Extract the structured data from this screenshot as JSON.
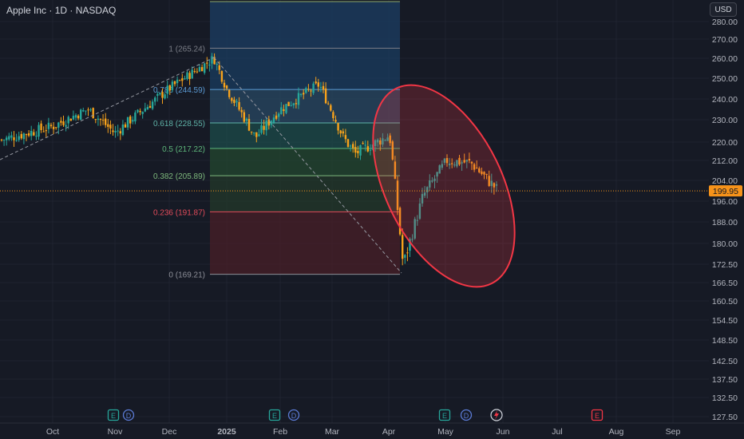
{
  "header": {
    "title": "Apple Inc · 1D · NASDAQ",
    "currency": "USD"
  },
  "colors": {
    "background": "#161a25",
    "up": "#26a69a",
    "down": "#f7a21b",
    "ellipse": "#f23645",
    "last_price_bg": "#f7931a"
  },
  "chart_data": {
    "type": "candlestick",
    "title": "",
    "xlabel": "",
    "ylabel": "",
    "ylim": [
      125,
      284
    ],
    "y_ticks": [
      "280.00",
      "270.00",
      "260.00",
      "250.00",
      "240.00",
      "230.00",
      "220.00",
      "212.00",
      "204.00",
      "196.00",
      "188.00",
      "180.00",
      "172.50",
      "166.50",
      "160.50",
      "154.50",
      "148.50",
      "142.50",
      "137.50",
      "132.50",
      "127.50"
    ],
    "x_ticks": [
      "Oct",
      "Nov",
      "Dec",
      "2025",
      "Feb",
      "Mar",
      "Apr",
      "May",
      "Jun",
      "Jul",
      "Aug",
      "Sep"
    ],
    "last_price": "199.95",
    "fibonacci_levels": [
      {
        "ratio": "1",
        "label": "1 (265.24)",
        "value": 265.24
      },
      {
        "ratio": "0.786",
        "label": "0.786 (244.59)",
        "value": 244.59
      },
      {
        "ratio": "0.618",
        "label": "0.618 (228.55)",
        "value": 228.55
      },
      {
        "ratio": "0.5",
        "label": "0.5 (217.22)",
        "value": 217.22
      },
      {
        "ratio": "0.382",
        "label": "0.382 (205.89)",
        "value": 205.89
      },
      {
        "ratio": "0.236",
        "label": "0.236 (191.87)",
        "value": 191.87
      },
      {
        "ratio": "0",
        "label": "0 (169.21)",
        "value": 169.21
      }
    ],
    "events": [
      {
        "letter": "E",
        "type": "earnings",
        "tick": "Nov"
      },
      {
        "letter": "D",
        "type": "dividend",
        "tick": "Nov"
      },
      {
        "letter": "E",
        "type": "earnings",
        "tick": "Feb"
      },
      {
        "letter": "D",
        "type": "dividend",
        "tick": "Feb"
      },
      {
        "letter": "E",
        "type": "earnings",
        "tick": "May"
      },
      {
        "letter": "D",
        "type": "dividend",
        "tick": "May"
      },
      {
        "letter": "E",
        "type": "earnings-upcoming",
        "tick": "Aug"
      }
    ],
    "series": [
      {
        "date": "Sep",
        "close": 221
      },
      {
        "date": "Oct",
        "close": 227
      },
      {
        "date": "Oct-late",
        "close": 235
      },
      {
        "date": "Nov",
        "close": 224
      },
      {
        "date": "Dec",
        "close": 245
      },
      {
        "date": "Dec-late",
        "close": 260
      },
      {
        "date": "2025",
        "close": 245
      },
      {
        "date": "Jan-mid",
        "close": 222
      },
      {
        "date": "Feb",
        "close": 235
      },
      {
        "date": "Feb-mid",
        "close": 247
      },
      {
        "date": "Mar",
        "close": 222
      },
      {
        "date": "Mar-mid",
        "close": 215
      },
      {
        "date": "Apr",
        "close": 223
      },
      {
        "date": "Apr-8",
        "close": 172
      },
      {
        "date": "Apr-mid",
        "close": 198
      },
      {
        "date": "May",
        "close": 212
      },
      {
        "date": "May-mid",
        "close": 211
      },
      {
        "date": "Jun",
        "close": 200
      }
    ]
  }
}
